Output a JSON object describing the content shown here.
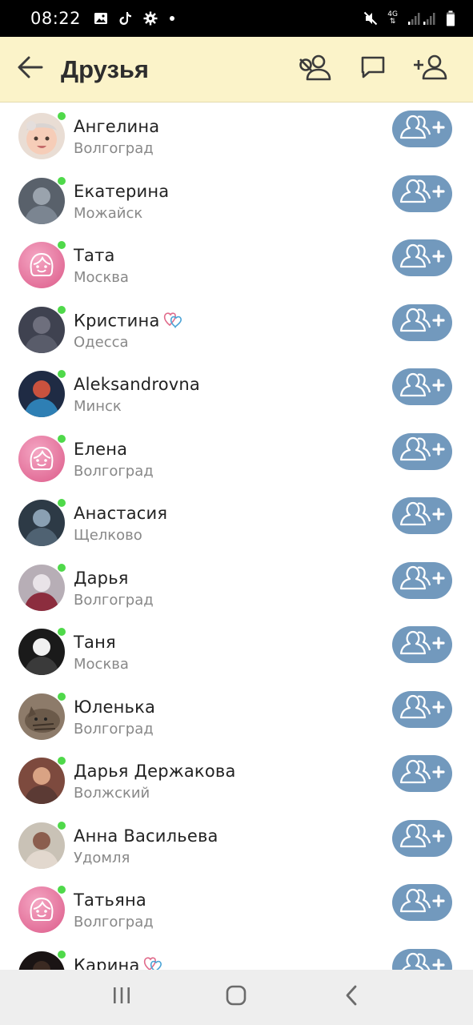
{
  "status_bar": {
    "time": "08:22",
    "icons_left": [
      "gallery-icon",
      "tiktok-icon",
      "gear-icon",
      "dot-icon"
    ],
    "network_label": "4G",
    "icons_right": [
      "mute-icon",
      "signal-icon",
      "battery-icon"
    ]
  },
  "header": {
    "title": "Друзья",
    "background": "#fbf3c9",
    "actions": [
      "friends-remove-icon",
      "message-icon",
      "add-friend-icon"
    ]
  },
  "friends": [
    {
      "name": "Ангелина",
      "city": "Волгоград",
      "online": true,
      "avatar": "baby-photo"
    },
    {
      "name": "Екатерина",
      "city": "Можайск",
      "online": true,
      "avatar": "photo"
    },
    {
      "name": "Тата",
      "city": "Москва",
      "online": true,
      "avatar": "default-female"
    },
    {
      "name": "Кристина",
      "city": "Одесса",
      "online": true,
      "avatar": "photo",
      "badge": "hearts-badge"
    },
    {
      "name": "Aleksandrovna",
      "city": "Минск",
      "online": true,
      "avatar": "photo"
    },
    {
      "name": "Елена",
      "city": "Волгоград",
      "online": true,
      "avatar": "default-female"
    },
    {
      "name": "Анастасия",
      "city": "Щелково",
      "online": true,
      "avatar": "photo"
    },
    {
      "name": "Дарья",
      "city": "Волгоград",
      "online": true,
      "avatar": "photo"
    },
    {
      "name": "Таня",
      "city": "Москва",
      "online": true,
      "avatar": "photo"
    },
    {
      "name": "Юленька",
      "city": "Волгоград",
      "online": true,
      "avatar": "cat-photo"
    },
    {
      "name": "Дарья Держакова",
      "city": "Волжский",
      "online": true,
      "avatar": "photo"
    },
    {
      "name": "Анна Васильева",
      "city": "Удомля",
      "online": true,
      "avatar": "photo"
    },
    {
      "name": "Татьяна",
      "city": "Волгоград",
      "online": true,
      "avatar": "default-female"
    },
    {
      "name": "Карина",
      "city": "",
      "online": true,
      "avatar": "photo",
      "badge": "hearts-badge"
    }
  ],
  "colors": {
    "accent_button": "#7299bd",
    "online": "#4fd94a",
    "default_avatar": "#e77aa2"
  },
  "nav_bar": {
    "buttons": [
      "recents-icon",
      "home-icon",
      "back-icon"
    ]
  }
}
